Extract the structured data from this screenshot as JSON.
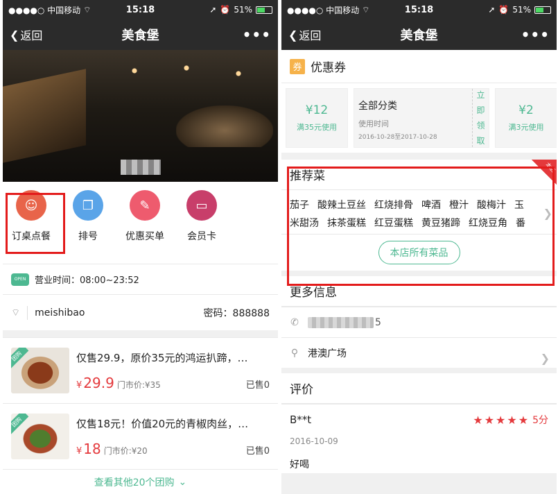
{
  "status": {
    "carrier": "●●●●○ 中国移动",
    "wifi_icon": "wifi-icon",
    "time": "15:18",
    "battery": "51%"
  },
  "nav": {
    "back_label": "返回",
    "title": "美食堡",
    "more_label": "•••"
  },
  "left": {
    "actions": [
      {
        "label": "订桌点餐",
        "color": "#e8644a",
        "glyph": "☺"
      },
      {
        "label": "排号",
        "color": "#5aa4e8",
        "glyph": "❐"
      },
      {
        "label": "优惠买单",
        "color": "#ee5b6e",
        "glyph": "✎"
      },
      {
        "label": "会员卡",
        "color": "#c83e6a",
        "glyph": "▭"
      }
    ],
    "open_badge": "OPEN",
    "hours": "营业时间：08:00~23:52",
    "wifi_name": "meishibao",
    "wifi_password": "密码：888888",
    "deals": [
      {
        "tag": "团购",
        "name": "仅售29.9，原价35元的鸿运扒蹄，…",
        "currency": "¥",
        "price": "29.9",
        "orig": "门市价:¥35",
        "sold": "已售0"
      },
      {
        "tag": "团购",
        "name": "仅售18元！价值20元的青椒肉丝，…",
        "currency": "¥",
        "price": "18",
        "orig": "门市价:¥20",
        "sold": "已售0"
      }
    ],
    "more_deals": "查看其他20个团购",
    "more_deals_chevron": "⌄"
  },
  "right": {
    "coupon_icon": "券",
    "coupon_title": "优惠券",
    "coupons_left": {
      "amount": "¥12",
      "cond": "满35元使用"
    },
    "coupon_mid": {
      "category": "全部分类",
      "use_time": "使用时间",
      "dates": "2016-10-28至2017-10-28",
      "claim": [
        "立",
        "即",
        "领",
        "取"
      ]
    },
    "coupons_right": {
      "amount": "¥2",
      "cond": "满3元使用"
    },
    "rec_title": "推荐菜",
    "rec_corner": "本店",
    "dishes_line1": [
      "茄子",
      "酸辣土豆丝",
      "红烧排骨",
      "啤酒",
      "橙汁",
      "酸梅汁",
      "玉"
    ],
    "dishes_line2": [
      "米甜汤",
      "抹茶蛋糕",
      "红豆蛋糕",
      "黄豆猪蹄",
      "红烧豆角",
      "番"
    ],
    "all_dishes": "本店所有菜品",
    "more_info": "更多信息",
    "phone_tail": "5",
    "address": "港澳广场",
    "review_title": "评价",
    "review": {
      "user": "B**t",
      "stars": "★★★★★",
      "score": "5分",
      "date": "2016-10-09",
      "content": "好喝"
    }
  }
}
